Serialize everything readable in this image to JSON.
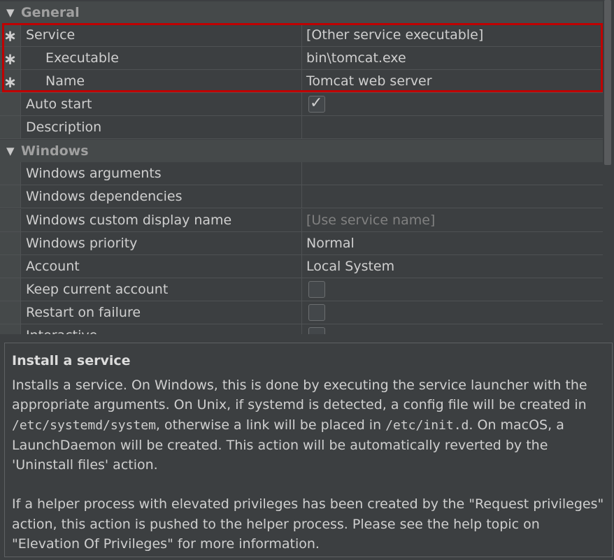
{
  "sections": [
    {
      "title": "General",
      "expanded": true
    },
    {
      "title": "Windows",
      "expanded": true
    }
  ],
  "general_rows": [
    {
      "name": "Service",
      "value": "[Other service executable]",
      "required": true,
      "indent": false
    },
    {
      "name": "Executable",
      "value": "bin\\tomcat.exe",
      "required": true,
      "indent": true
    },
    {
      "name": "Name",
      "value": "Tomcat web server",
      "required": true,
      "indent": true
    },
    {
      "name": "Auto start",
      "checkbox": true,
      "checked": true
    },
    {
      "name": "Description",
      "value": ""
    }
  ],
  "windows_rows": [
    {
      "name": "Windows arguments",
      "value": ""
    },
    {
      "name": "Windows dependencies",
      "value": ""
    },
    {
      "name": "Windows custom display name",
      "value": "[Use service name]",
      "placeholder": true
    },
    {
      "name": "Windows priority",
      "value": "Normal"
    },
    {
      "name": "Account",
      "value": "Local System"
    },
    {
      "name": "Keep current account",
      "checkbox": true,
      "checked": false
    },
    {
      "name": "Restart on failure",
      "checkbox": true,
      "checked": false
    },
    {
      "name": "Interactive",
      "checkbox": true,
      "checked": false
    }
  ],
  "required_marker": "∗",
  "expand_icon": "▼",
  "help": {
    "title": "Install a service",
    "p1_a": "Installs a service. On Windows, this is done by executing the service launcher with the appropriate arguments. On Unix, if systemd is detected, a config file will be created in ",
    "p1_code1": "/etc/systemd/system",
    "p1_b": ", otherwise a link will be placed in ",
    "p1_code2": "/etc/init.d",
    "p1_c": ". On macOS, a LaunchDaemon will be created. This action will be automatically reverted by the 'Uninstall files' action.",
    "p2": "If a helper process with elevated privileges has been created by the \"Request privileges\" action, this action is pushed to the helper process. Please see the help topic on \"Elevation Of Privileges\" for more information."
  },
  "colors": {
    "highlight": "#c00000",
    "background": "#3c3f41"
  }
}
